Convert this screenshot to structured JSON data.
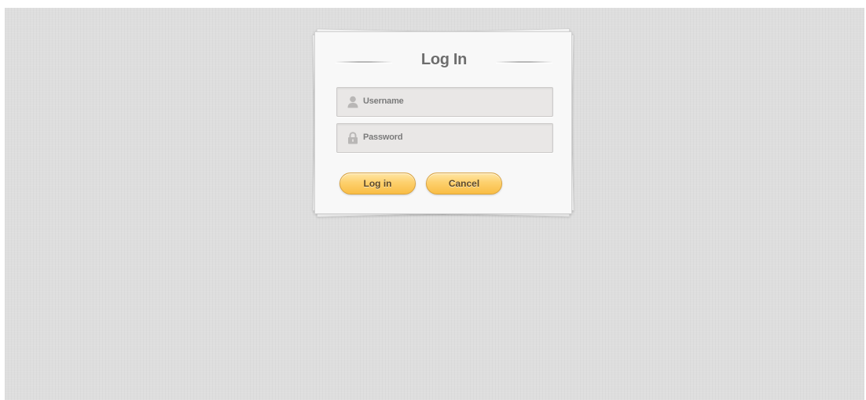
{
  "login_dialog": {
    "title": "Log In",
    "username": {
      "placeholder": "Username",
      "value": "",
      "icon": "user-icon"
    },
    "password": {
      "placeholder": "Password",
      "value": "",
      "icon": "lock-icon"
    },
    "buttons": {
      "login_label": "Log in",
      "cancel_label": "Cancel"
    }
  },
  "colors": {
    "background": "#dedede",
    "card": "#f8f8f8",
    "field": "#e9e7e6",
    "button_top": "#ffe6a6",
    "button_bottom": "#f9bd45",
    "title_text": "#6d6d6d"
  }
}
